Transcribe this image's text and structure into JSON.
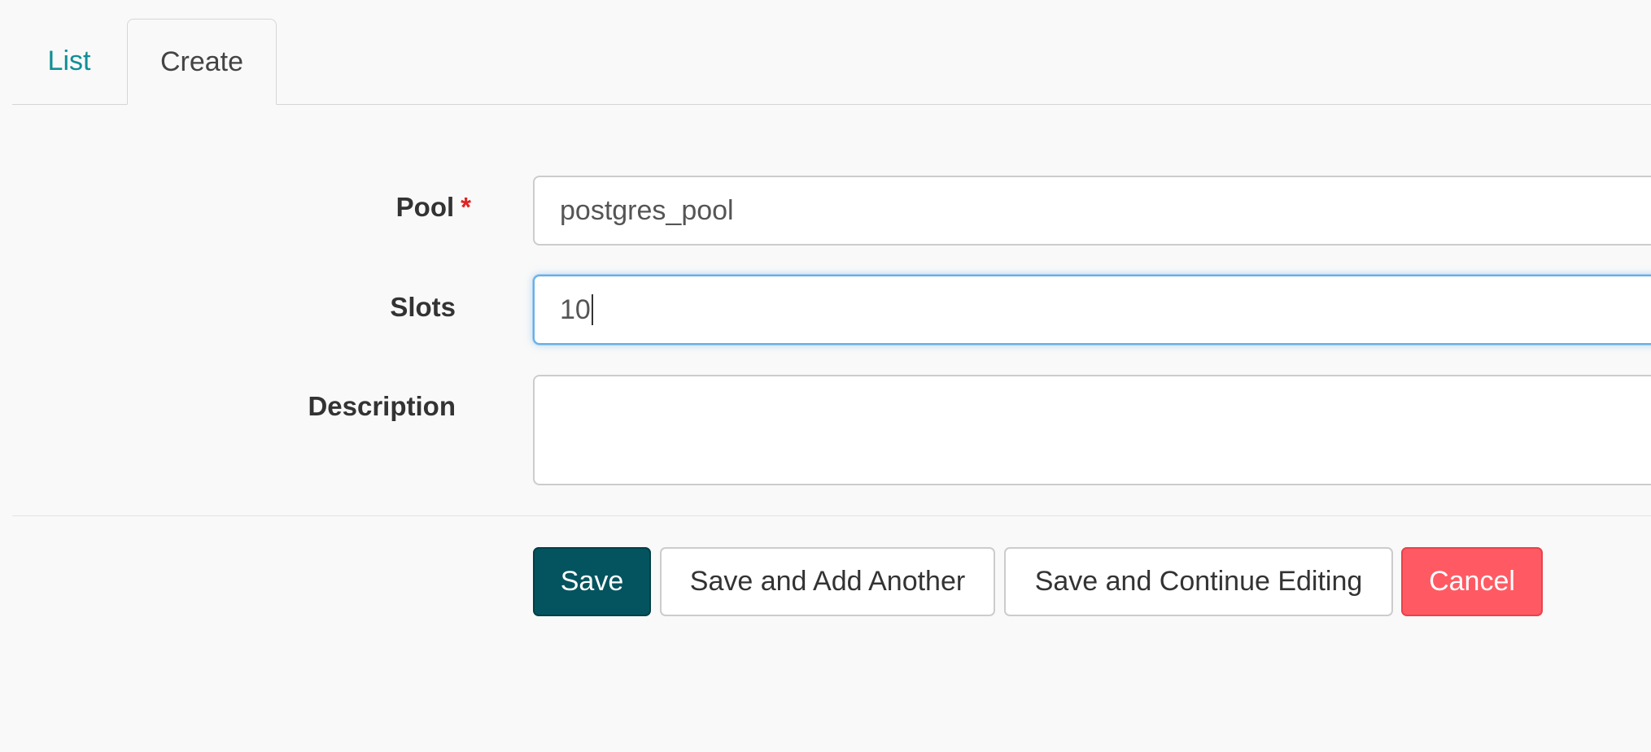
{
  "tabs": {
    "list_label": "List",
    "create_label": "Create"
  },
  "form": {
    "pool": {
      "label": "Pool",
      "required_mark": "*",
      "value": "postgres_pool"
    },
    "slots": {
      "label": "Slots",
      "value": "10"
    },
    "description": {
      "label": "Description",
      "value": ""
    }
  },
  "actions": {
    "save_label": "Save",
    "save_add_label": "Save and Add Another",
    "save_continue_label": "Save and Continue Editing",
    "cancel_label": "Cancel"
  },
  "colors": {
    "accent_link": "#0f8f95",
    "save_button": "#03545f",
    "cancel_button": "#ff5a63",
    "required_mark": "#e02424",
    "focus_border": "#66afe9"
  }
}
